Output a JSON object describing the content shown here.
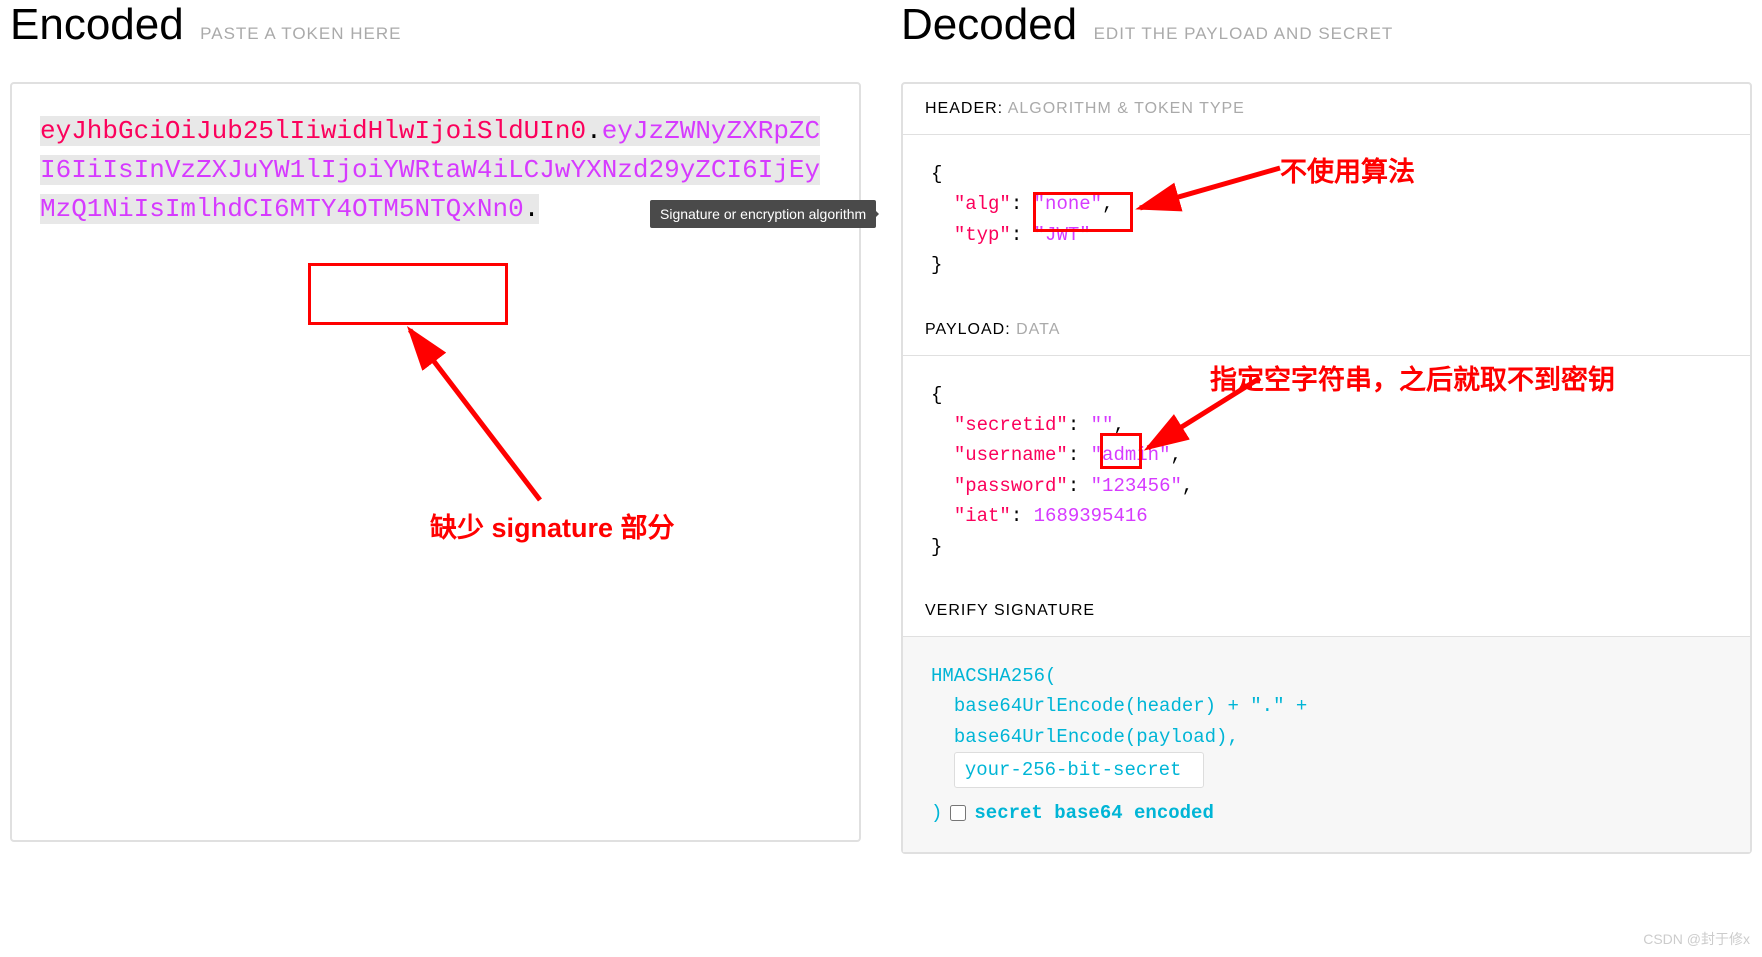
{
  "encoded": {
    "title": "Encoded",
    "subtitle": "PASTE A TOKEN HERE",
    "header_part": "eyJhbGciOiJub25lIiwidHlwIjoiSldUIn0",
    "payload_part": "eyJzZWNyZXRpZCI6IiIsInVzZXJuYW1lIjoiYWRtaW4iLCJwYXNzd29yZCI6IjEyMzQ1NiIsImlhdCI6MTY4OTM5NTQxNn0",
    "dot": "."
  },
  "decoded": {
    "title": "Decoded",
    "subtitle": "EDIT THE PAYLOAD AND SECRET",
    "header_section": {
      "label": "HEADER:",
      "sublabel": "ALGORITHM & TOKEN TYPE",
      "alg_key": "\"alg\"",
      "alg_val": "\"none\"",
      "typ_key": "\"typ\"",
      "typ_val": "\"JWT\""
    },
    "payload_section": {
      "label": "PAYLOAD:",
      "sublabel": "DATA",
      "rows": [
        {
          "k": "\"secretid\"",
          "v": "\"\""
        },
        {
          "k": "\"username\"",
          "v": "\"admin\""
        },
        {
          "k": "\"password\"",
          "v": "\"123456\""
        },
        {
          "k": "\"iat\"",
          "v": "1689395416"
        }
      ]
    },
    "signature_section": {
      "label": "VERIFY SIGNATURE",
      "line1": "HMACSHA256(",
      "line2": "base64UrlEncode(header) + \".\" +",
      "line3": "base64UrlEncode(payload),",
      "secret_placeholder": "your-256-bit-secret",
      "close": ")",
      "checkbox_label": "secret base64 encoded"
    }
  },
  "annotations": {
    "tooltip": "Signature or encryption algorithm",
    "missing_sig": "缺少 signature 部分",
    "no_alg": "不使用算法",
    "empty_secret": "指定空字符串，之后就取不到密钥",
    "watermark": "CSDN @封于修x"
  }
}
